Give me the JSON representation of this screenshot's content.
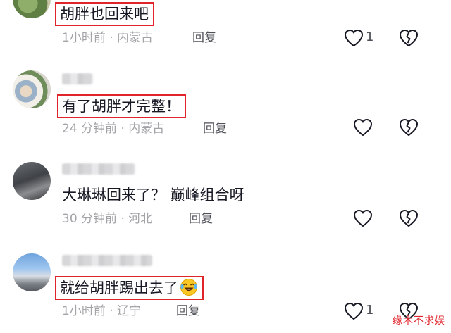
{
  "comments": [
    {
      "text": "胡胖也回来吧",
      "time": "1小时前",
      "location": "内蒙古",
      "reply_label": "回复",
      "likes": "1"
    },
    {
      "text": "有了胡胖才完整！",
      "time": "24 分钟前",
      "location": "内蒙古",
      "reply_label": "回复"
    },
    {
      "text": "大琳琳回来了？ 巅峰组合呀",
      "time": "30 分钟前",
      "location": "河北",
      "reply_label": "回复"
    },
    {
      "text": "就给胡胖踢出去了",
      "emoji": "laughing-crying-emoji",
      "time": "1小时前",
      "location": "辽宁",
      "reply_label": "回复",
      "likes": "1"
    }
  ],
  "separator": " · ",
  "watermark": "缘木不求娱",
  "icons": [
    "heart-icon",
    "broken-heart-icon",
    "avatar"
  ],
  "colors": {
    "highlight_box": "#e0242b",
    "meta_text": "#a3a4a8",
    "body_text": "#161823",
    "icon_stroke": "#161823"
  }
}
